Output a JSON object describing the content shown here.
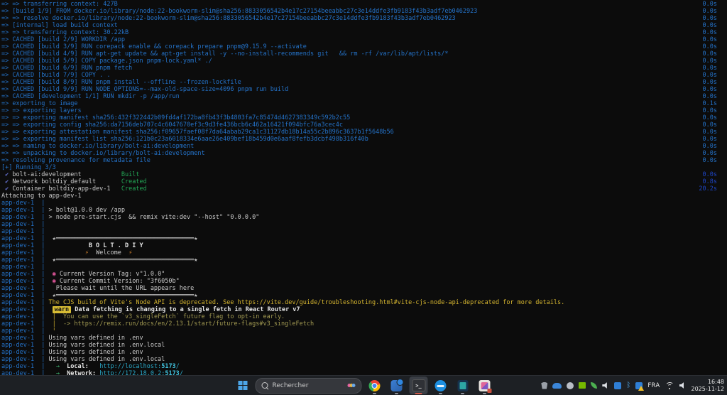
{
  "colors": {
    "terminal_bg": "#0c0c0c",
    "terminal_blue": "#2472c8",
    "terminal_green": "#23a455",
    "terminal_yellow": "#d6b630",
    "terminal_cyan": "#2aa9c9",
    "checkmark_blue": "#6470cf",
    "taskbar_bg": "#1d2024",
    "active_underline": "#d15a4a"
  },
  "terminal": {
    "lines": [
      {
        "s": [
          [
            "b",
            "=> => transferring context: 427B"
          ]
        ],
        "t": "0.0s"
      },
      {
        "s": [
          [
            "b",
            "=> [build 1/9] FROM docker.io/library/node:22-bookworm-slim@sha256:8833056542b4e17c27154beeabbc27c3e14ddfe3fb9183f43b3adf7eb0462923"
          ]
        ],
        "t": "0.0s"
      },
      {
        "s": [
          [
            "b",
            "=> => resolve docker.io/library/node:22-bookworm-slim@sha256:8833056542b4e17c27154beeabbc27c3e14ddfe3fb9183f43b3adf7eb0462923"
          ]
        ],
        "t": "0.0s"
      },
      {
        "s": [
          [
            "b",
            "=> [internal] load build context"
          ]
        ],
        "t": "0.0s"
      },
      {
        "s": [
          [
            "b",
            "=> => transferring context: 30.22kB"
          ]
        ],
        "t": "0.0s"
      },
      {
        "s": [
          [
            "b",
            "=> CACHED [build 2/9] WORKDIR /app"
          ]
        ],
        "t": "0.0s"
      },
      {
        "s": [
          [
            "b",
            "=> CACHED [build 3/9] RUN corepack enable && corepack prepare pnpm@9.15.9 --activate"
          ]
        ],
        "t": "0.0s"
      },
      {
        "s": [
          [
            "b",
            "=> CACHED [build 4/9] RUN apt-get update && apt-get install -y --no-install-recommends git   && rm -rf /var/lib/apt/lists/*"
          ]
        ],
        "t": "0.0s"
      },
      {
        "s": [
          [
            "b",
            "=> CACHED [build 5/9] COPY package.json pnpm-lock.yaml* ./"
          ]
        ],
        "t": "0.0s"
      },
      {
        "s": [
          [
            "b",
            "=> CACHED [build 6/9] RUN pnpm fetch"
          ]
        ],
        "t": "0.0s"
      },
      {
        "s": [
          [
            "b",
            "=> CACHED [build 7/9] COPY . ."
          ]
        ],
        "t": "0.0s"
      },
      {
        "s": [
          [
            "b",
            "=> CACHED [build 8/9] RUN pnpm install --offline --frozen-lockfile"
          ]
        ],
        "t": "0.0s"
      },
      {
        "s": [
          [
            "b",
            "=> CACHED [build 9/9] RUN NODE_OPTIONS=--max-old-space-size=4096 pnpm run build"
          ]
        ],
        "t": "0.0s"
      },
      {
        "s": [
          [
            "b",
            "=> CACHED [development 1/1] RUN mkdir -p /app/run"
          ]
        ],
        "t": "0.0s"
      },
      {
        "s": [
          [
            "b",
            "=> exporting to image"
          ]
        ],
        "t": "0.1s"
      },
      {
        "s": [
          [
            "b",
            "=> => exporting layers"
          ]
        ],
        "t": "0.0s"
      },
      {
        "s": [
          [
            "b",
            "=> => exporting manifest sha256:432f322442b09fd4af172ba8fb43f3b4803fa7c85474d4627383349c592b2c55"
          ]
        ],
        "t": "0.0s"
      },
      {
        "s": [
          [
            "b",
            "=> => exporting config sha256:da7156deb707c4c6047670ef3c9d3fe436bcb6c462a16421f094bfc76a3cec4c"
          ]
        ],
        "t": "0.0s"
      },
      {
        "s": [
          [
            "b",
            "=> => exporting attestation manifest sha256:f09657faef08f7da64abab29ca1c31127db18b14a55c2b896c3637b1f5648b56"
          ]
        ],
        "t": "0.0s"
      },
      {
        "s": [
          [
            "b",
            "=> => exporting manifest list sha256:121b0c23a6018334e6aae26e409bef18b459d0e6aaf8fefb3dcbf498b316f40b"
          ]
        ],
        "t": "0.0s"
      },
      {
        "s": [
          [
            "b",
            "=> => naming to docker.io/library/bolt-ai:development"
          ]
        ],
        "t": "0.0s"
      },
      {
        "s": [
          [
            "b",
            "=> => unpacking to docker.io/library/bolt-ai:development"
          ]
        ],
        "t": "0.0s"
      },
      {
        "s": [
          [
            "b",
            "=> resolving provenance for metadata file"
          ]
        ],
        "t": "0.0s"
      },
      {
        "s": [
          [
            "b",
            "[+] Running 3/3"
          ]
        ]
      },
      {
        "s": [
          [
            "ck",
            " ✔ "
          ],
          [
            "w",
            "bolt-ai:development           "
          ],
          [
            "g",
            "Built"
          ]
        ],
        "t": "0.0s",
        "tc": "d"
      },
      {
        "s": [
          [
            "ck",
            " ✔ "
          ],
          [
            "w",
            "Network boltdiy_default       "
          ],
          [
            "g",
            "Created"
          ]
        ],
        "t": "0.8s",
        "tc": "d"
      },
      {
        "s": [
          [
            "ck",
            " ✔ "
          ],
          [
            "w",
            "Container boltdiy-app-dev-1   "
          ],
          [
            "g",
            "Created"
          ]
        ],
        "t": "20.2s",
        "tc": "d"
      },
      {
        "s": [
          [
            "w",
            "Attaching to app-dev-1"
          ]
        ]
      },
      {
        "s": [
          [
            "b",
            "app-dev-1  | "
          ]
        ]
      },
      {
        "s": [
          [
            "b",
            "app-dev-1  | "
          ],
          [
            "w",
            "> bolt@1.0.0 dev /app"
          ]
        ]
      },
      {
        "s": [
          [
            "b",
            "app-dev-1  | "
          ],
          [
            "w",
            "> node pre-start.cjs  && remix vite:dev \"--host\" \"0.0.0.0\""
          ]
        ]
      },
      {
        "s": [
          [
            "b",
            "app-dev-1  | "
          ]
        ]
      },
      {
        "s": [
          [
            "b",
            "app-dev-1  | "
          ]
        ]
      },
      {
        "s": [
          [
            "b",
            "app-dev-1  | "
          ],
          [
            "w",
            " ★══════════════════════════════════════★"
          ]
        ]
      },
      {
        "s": [
          [
            "b",
            "app-dev-1  | "
          ],
          [
            "bw",
            "           B O L T . D I Y"
          ]
        ]
      },
      {
        "s": [
          [
            "b",
            "app-dev-1  | "
          ],
          [
            "w",
            "          "
          ],
          [
            "o",
            "⚡"
          ],
          [
            "w",
            "  Welcome  "
          ],
          [
            "o",
            "⚡"
          ]
        ]
      },
      {
        "s": [
          [
            "b",
            "app-dev-1  | "
          ],
          [
            "w",
            " ★══════════════════════════════════════★"
          ]
        ]
      },
      {
        "s": [
          [
            "b",
            "app-dev-1  | "
          ]
        ]
      },
      {
        "s": [
          [
            "b",
            "app-dev-1  | "
          ],
          [
            "p",
            " ◉"
          ],
          [
            "w",
            " Current Version Tag: v\"1.0.0\""
          ]
        ]
      },
      {
        "s": [
          [
            "b",
            "app-dev-1  | "
          ],
          [
            "p",
            " ◉"
          ],
          [
            "w",
            " Current Commit Version: \"3f6050b\""
          ]
        ]
      },
      {
        "s": [
          [
            "b",
            "app-dev-1  | "
          ],
          [
            "w",
            "  Please wait until the URL appears here"
          ]
        ]
      },
      {
        "s": [
          [
            "b",
            "app-dev-1  | "
          ],
          [
            "w",
            " ★══════════════════════════════════════★"
          ]
        ]
      },
      {
        "s": [
          [
            "b",
            "app-dev-1  | "
          ],
          [
            "y",
            "The CJS build of Vite's Node API is deprecated. See https://vite.dev/guide/troubleshooting.html#vite-cjs-node-api-deprecated for more details."
          ]
        ]
      },
      {
        "s": [
          [
            "b",
            "app-dev-1  | "
          ],
          [
            "w",
            " "
          ],
          [
            "wb",
            "warn"
          ],
          [
            "bw",
            " Data fetching is changing to a single fetch in React Router v7"
          ]
        ]
      },
      {
        "s": [
          [
            "b",
            "app-dev-1  | "
          ],
          [
            "yb",
            " │"
          ],
          [
            "dy",
            "  You can use the `v3_singleFetch` future flag to opt-in early."
          ]
        ]
      },
      {
        "s": [
          [
            "b",
            "app-dev-1  | "
          ],
          [
            "yb",
            " │"
          ],
          [
            "dy",
            "  -> https://remix.run/docs/en/2.13.1/start/future-flags#v3_singleFetch"
          ]
        ]
      },
      {
        "s": [
          [
            "b",
            "app-dev-1  | "
          ],
          [
            "yb",
            " ╵"
          ]
        ]
      },
      {
        "s": [
          [
            "b",
            "app-dev-1  | "
          ],
          [
            "w",
            "Using vars defined in .env"
          ]
        ]
      },
      {
        "s": [
          [
            "b",
            "app-dev-1  | "
          ],
          [
            "w",
            "Using vars defined in .env.local"
          ]
        ]
      },
      {
        "s": [
          [
            "b",
            "app-dev-1  | "
          ],
          [
            "w",
            "Using vars defined in .env"
          ]
        ]
      },
      {
        "s": [
          [
            "b",
            "app-dev-1  | "
          ],
          [
            "w",
            "Using vars defined in .env.local"
          ]
        ]
      },
      {
        "s": [
          [
            "b",
            "app-dev-1  | "
          ],
          [
            "ga",
            "  → "
          ],
          [
            "bw",
            " Local:"
          ],
          [
            "w",
            "   "
          ],
          [
            "c",
            "http://localhost:"
          ],
          [
            "bc",
            "5173"
          ],
          [
            "c",
            "/"
          ]
        ]
      },
      {
        "s": [
          [
            "b",
            "app-dev-1  | "
          ],
          [
            "ga",
            "  → "
          ],
          [
            "bw",
            " Network:"
          ],
          [
            "w",
            " "
          ],
          [
            "c",
            "http://172.18.0.2:"
          ],
          [
            "bc",
            "5173"
          ],
          [
            "c",
            "/"
          ]
        ]
      }
    ]
  },
  "taskbar": {
    "search_placeholder": "Rechercher",
    "terminal_icon_glyph": ">_",
    "pinned_apps": [
      "chrome",
      "remote-tool",
      "terminal",
      "docker-desktop",
      "notepad",
      "photos"
    ],
    "active_app": "terminal",
    "tray": {
      "language": "FRA",
      "time": "16:48",
      "date": "2025-11-12",
      "icons": [
        "shield-icon",
        "onedrive-icon",
        "steam-icon",
        "nvidia-icon",
        "leaf-icon",
        "audio-icon",
        "app-square-icon",
        "bluetooth-icon",
        "network-warning-icon",
        "wifi-icon",
        "volume-icon"
      ]
    }
  }
}
